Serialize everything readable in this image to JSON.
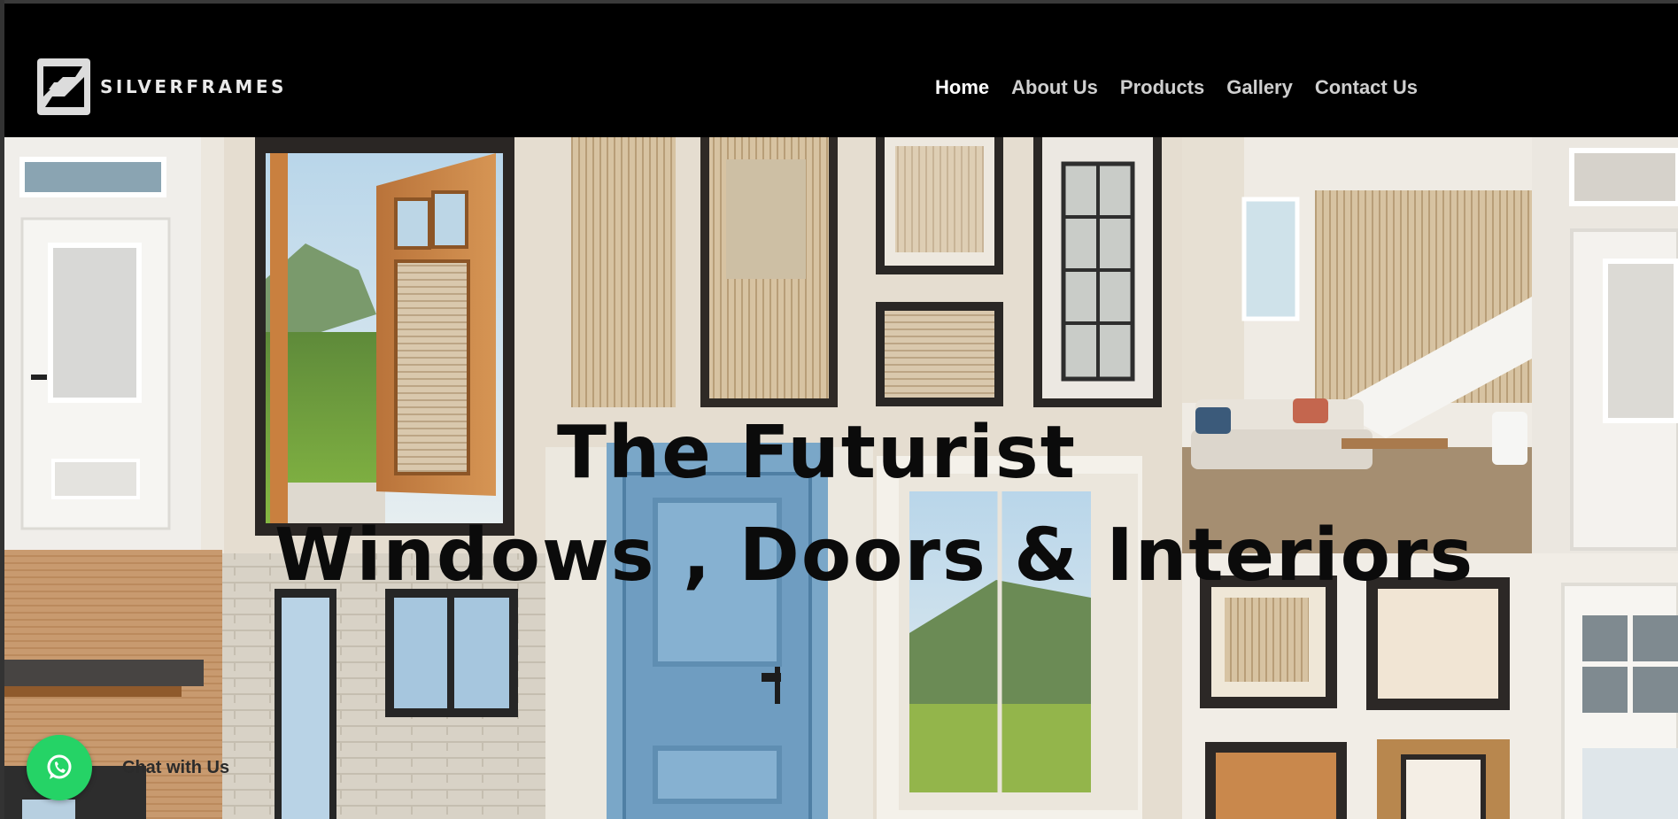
{
  "brand": {
    "name": "SILVERFRAMES"
  },
  "nav": {
    "items": [
      {
        "label": "Home",
        "active": true
      },
      {
        "label": "About Us",
        "active": false
      },
      {
        "label": "Products",
        "active": false
      },
      {
        "label": "Gallery",
        "active": false
      },
      {
        "label": "Contact Us",
        "active": false
      }
    ]
  },
  "hero": {
    "headline_line1": "The Futurist",
    "headline_line2": "Windows , Doors & Interiors"
  },
  "chat": {
    "label": "Chat with Us",
    "icon": "whatsapp-icon",
    "color": "#25d366"
  },
  "colors": {
    "navbar_bg": "#000000",
    "nav_text": "#cfcfcf",
    "nav_active": "#ffffff",
    "headline": "#0b0b0b"
  }
}
